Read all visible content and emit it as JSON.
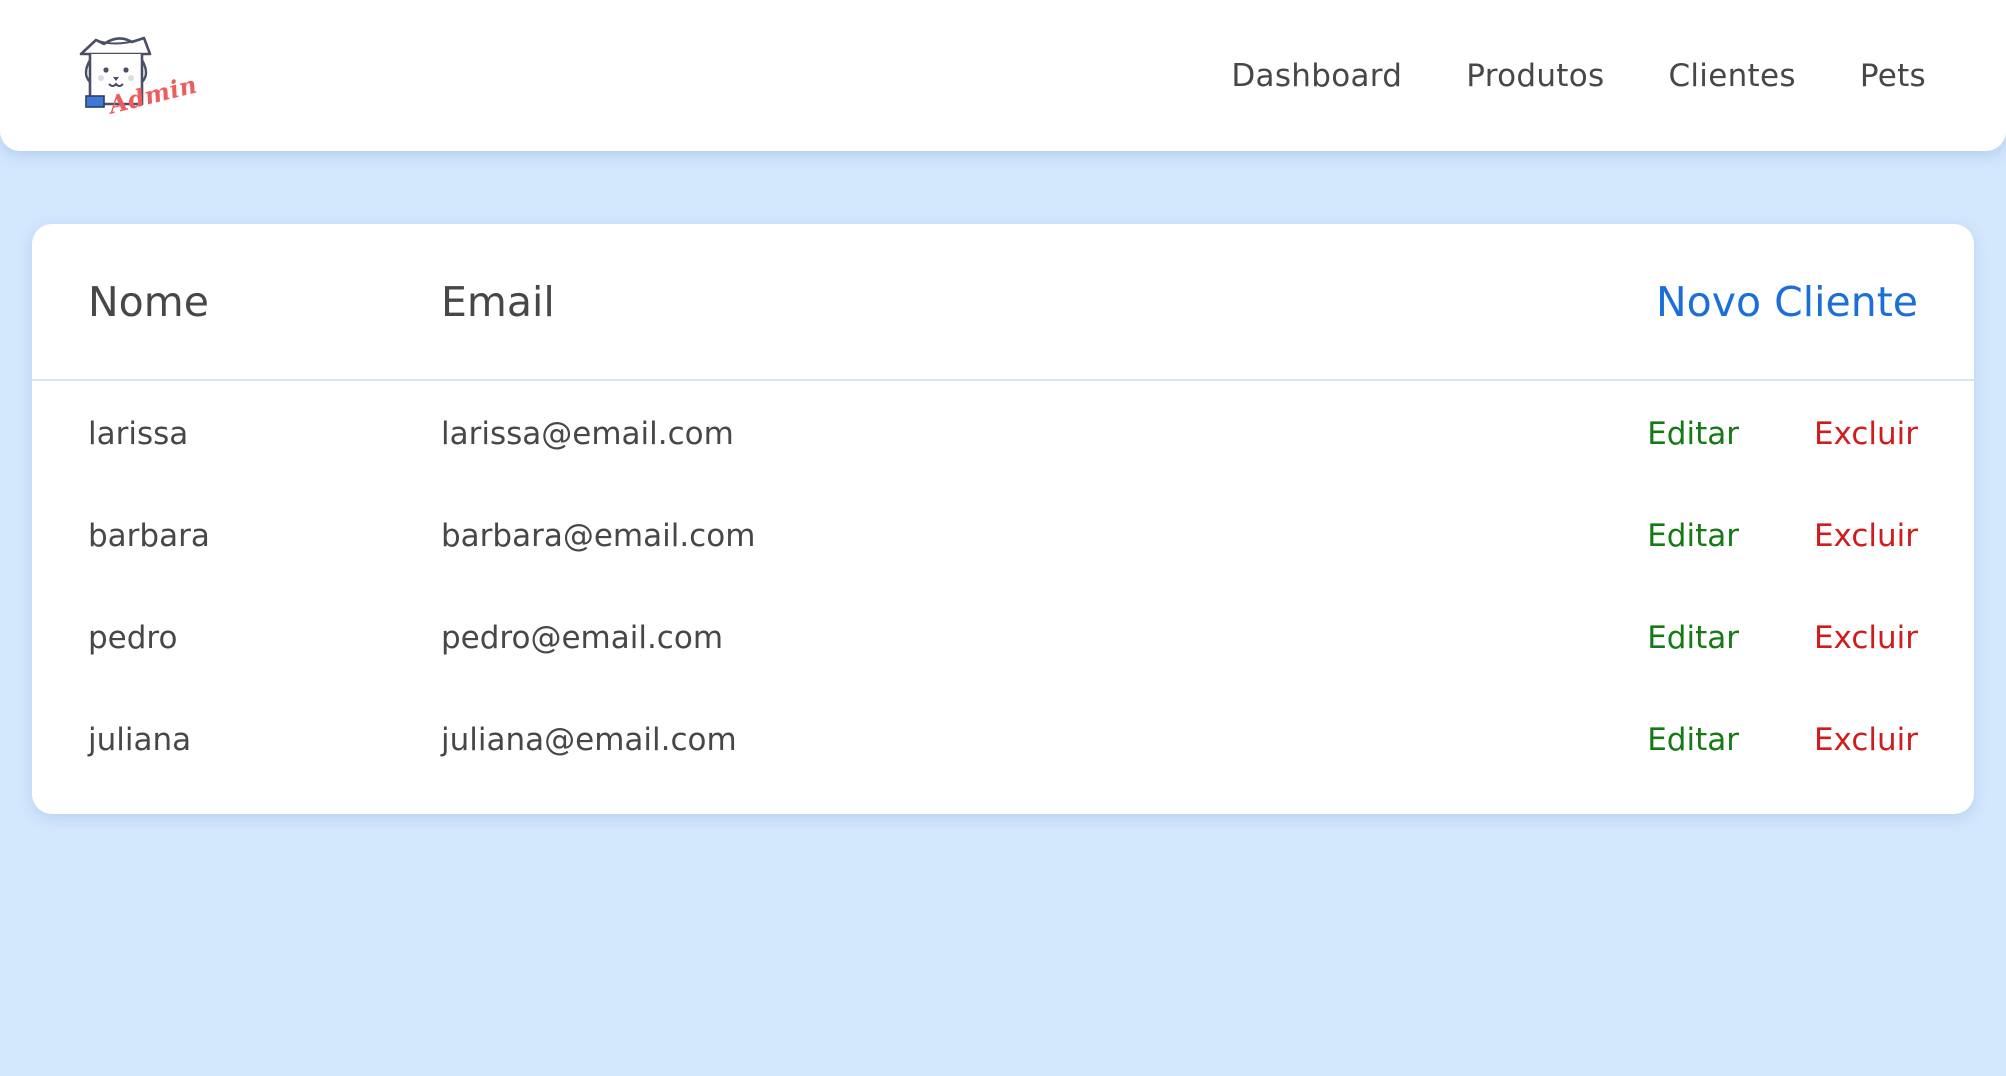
{
  "header": {
    "logo_text": "Admin",
    "nav": [
      {
        "label": "Dashboard"
      },
      {
        "label": "Produtos"
      },
      {
        "label": "Clientes"
      },
      {
        "label": "Pets"
      }
    ]
  },
  "table": {
    "columns": {
      "nome": "Nome",
      "email": "Email"
    },
    "new_button_label": "Novo Cliente",
    "rows": [
      {
        "nome": "larissa",
        "email": "larissa@email.com",
        "edit": "Editar",
        "delete": "Excluir"
      },
      {
        "nome": "barbara",
        "email": "barbara@email.com",
        "edit": "Editar",
        "delete": "Excluir"
      },
      {
        "nome": "pedro",
        "email": "pedro@email.com",
        "edit": "Editar",
        "delete": "Excluir"
      },
      {
        "nome": "juliana",
        "email": "juliana@email.com",
        "edit": "Editar",
        "delete": "Excluir"
      }
    ]
  },
  "colors": {
    "background": "#d3e7fd",
    "text": "#474747",
    "primary": "#1a6fd8",
    "edit": "#157a15",
    "delete": "#cf1d1d"
  }
}
